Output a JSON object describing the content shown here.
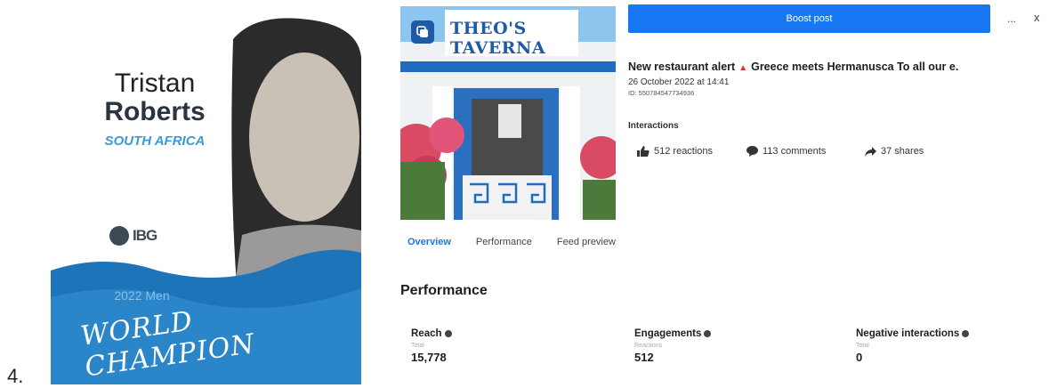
{
  "page_number": "4.",
  "athlete_card": {
    "first_name": "Tristan",
    "last_name": "Roberts",
    "country": "SOUTH AFRICA",
    "logo_text": "IBG",
    "year_text": "2022 Men",
    "banner_text": "WORLD CHAMPION"
  },
  "post_image": {
    "sign_text": "THEO'S TAVERNA"
  },
  "header": {
    "boost_label": "Boost post",
    "more_label": "...",
    "close_label": "x"
  },
  "post": {
    "title_start": "New restaurant alert",
    "title_end": "Greece meets Hermanusca To all our e.",
    "date": "26 October 2022 at 14:41",
    "id_text": "ID: 550784547734936",
    "interactions_label": "Interactions",
    "reactions": "512 reactions",
    "comments": "113 comments",
    "shares": "37 shares"
  },
  "tabs": [
    {
      "label": "Overview",
      "active": true
    },
    {
      "label": "Performance",
      "active": false
    },
    {
      "label": "Feed preview",
      "active": false
    }
  ],
  "performance": {
    "section_title": "Performance",
    "metrics": [
      {
        "label": "Reach",
        "sub": "Total",
        "value": "15,778"
      },
      {
        "label": "Engagements",
        "sub": "Reactions",
        "value": "512"
      },
      {
        "label": "Negative interactions",
        "sub": "Total",
        "value": "0"
      }
    ]
  },
  "colors": {
    "accent": "#1877f2",
    "card_blue": "#1e74b8",
    "country_blue": "#3a9ad8"
  }
}
